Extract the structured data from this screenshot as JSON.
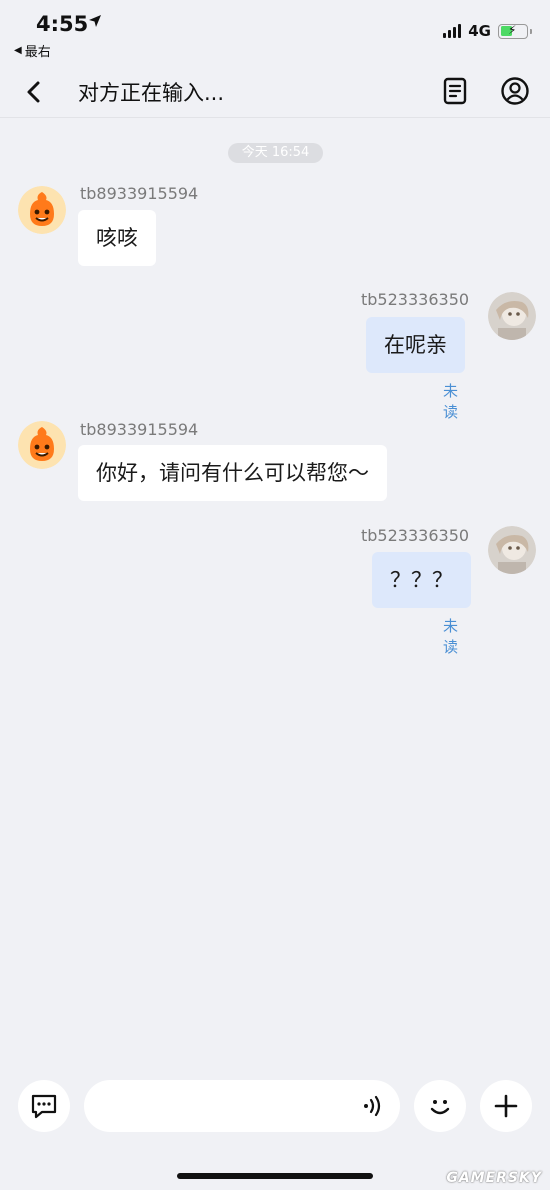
{
  "status_bar": {
    "time": "4:55",
    "back_app": "最右",
    "network": "4G"
  },
  "nav": {
    "title": "对方正在输入..."
  },
  "chat": {
    "timestamp": "今天 16:54",
    "messages": [
      {
        "side": "in",
        "sender": "tb8933915594",
        "text": "咳咳"
      },
      {
        "side": "out",
        "sender": "tb523336350",
        "text": "在呢亲",
        "status": "未读"
      },
      {
        "side": "in",
        "sender": "tb8933915594",
        "text": "你好，请问有什么可以帮您～"
      },
      {
        "side": "out",
        "sender": "tb523336350",
        "text": "？？？",
        "status": "未读"
      }
    ]
  },
  "input": {
    "value": "",
    "placeholder": ""
  },
  "watermark": "GAMERSKY",
  "colors": {
    "background": "#f0f1f5",
    "incoming_bubble": "#ffffff",
    "outgoing_bubble": "#dde8fb",
    "read_status": "#4a8fd4",
    "battery": "#4cd964"
  },
  "icons": [
    "location-arrow-icon",
    "back-triangle-icon",
    "signal-icon",
    "battery-icon",
    "chevron-left-icon",
    "document-list-icon",
    "user-profile-icon",
    "chat-bubble-icon",
    "voice-wave-icon",
    "smiley-icon",
    "plus-icon"
  ]
}
